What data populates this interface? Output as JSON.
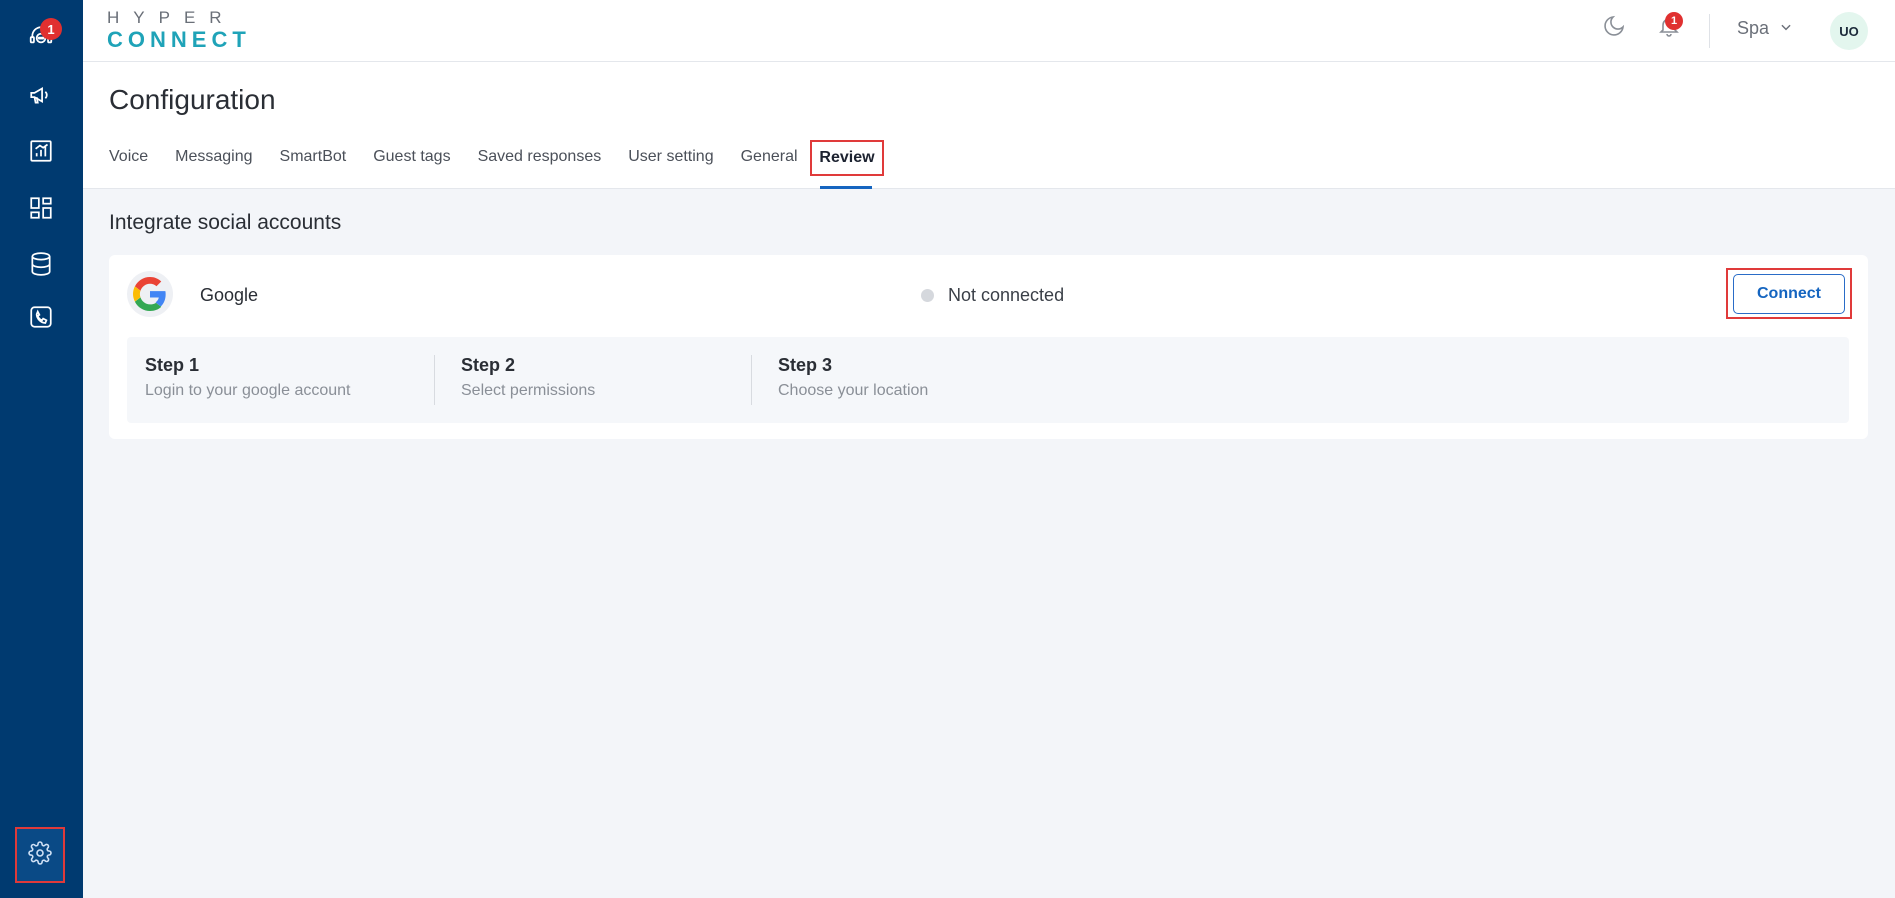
{
  "sidebar": {
    "items": [
      {
        "name": "support-chat",
        "icon": "headset-chat-icon",
        "badge": "1"
      },
      {
        "name": "campaigns",
        "icon": "megaphone-icon"
      },
      {
        "name": "reports",
        "icon": "bar-chart-icon"
      },
      {
        "name": "dashboard",
        "icon": "grid-icon"
      },
      {
        "name": "database",
        "icon": "database-icon"
      },
      {
        "name": "calls",
        "icon": "phone-icon"
      }
    ],
    "settings_icon": "gear-icon"
  },
  "topbar": {
    "logo_top": "HYPER",
    "logo_bottom": "CONNECT",
    "bell_badge": "1",
    "workspace": "Spa",
    "avatar": "UO"
  },
  "page": {
    "title": "Configuration",
    "tabs": [
      "Voice",
      "Messaging",
      "SmartBot",
      "Guest tags",
      "Saved responses",
      "User setting",
      "General",
      "Review"
    ],
    "active_tab": "Review"
  },
  "integrations": {
    "section_title": "Integrate social accounts",
    "google": {
      "name": "Google",
      "status": "Not connected",
      "connect_label": "Connect",
      "steps": [
        {
          "title": "Step 1",
          "desc": "Login to your google account"
        },
        {
          "title": "Step 2",
          "desc": "Select permissions"
        },
        {
          "title": "Step 3",
          "desc": "Choose your location"
        }
      ]
    }
  },
  "colors": {
    "sidebar_bg": "#003a70",
    "accent": "#1565c0",
    "badge": "#e03030",
    "highlight_box": "#e03a3a"
  }
}
